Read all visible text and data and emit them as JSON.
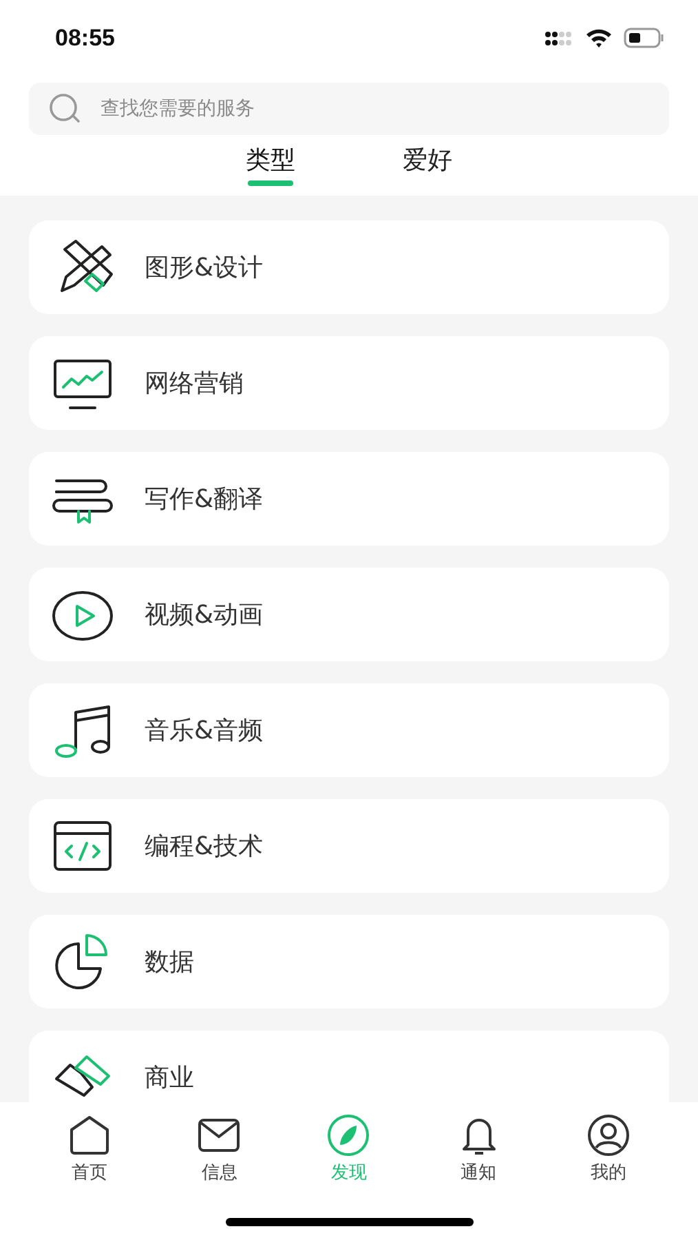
{
  "status_bar": {
    "time": "08:55"
  },
  "search": {
    "placeholder": "查找您需要的服务"
  },
  "tabs": [
    {
      "label": "类型",
      "selected": true
    },
    {
      "label": "爱好",
      "selected": false
    }
  ],
  "categories": [
    {
      "label": "图形&设计"
    },
    {
      "label": "网络营销"
    },
    {
      "label": "写作&翻译"
    },
    {
      "label": "视频&动画"
    },
    {
      "label": "音乐&音频"
    },
    {
      "label": "编程&技术"
    },
    {
      "label": "数据"
    },
    {
      "label": "商业"
    }
  ],
  "bottom_nav": [
    {
      "label": "首页",
      "selected": false
    },
    {
      "label": "信息",
      "selected": false
    },
    {
      "label": "发现",
      "selected": true
    },
    {
      "label": "通知",
      "selected": false
    },
    {
      "label": "我的",
      "selected": false
    }
  ]
}
